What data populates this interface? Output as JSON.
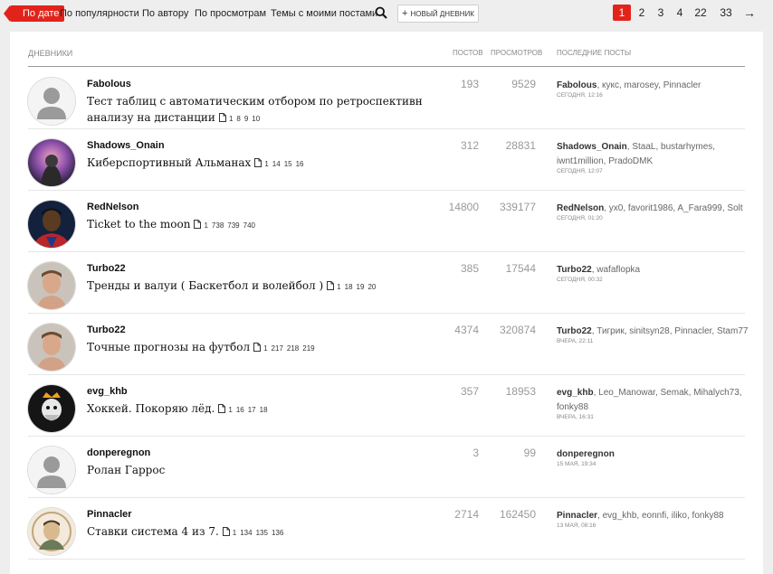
{
  "nav": {
    "active_sort": "По дате",
    "sorts": [
      "По популярности",
      "По автору",
      "По просмотрам",
      "Темы с моими постами"
    ],
    "new_diary": "новый дневник",
    "new_diary_plus": "+",
    "pages": [
      "1",
      "2",
      "3",
      "4",
      "22",
      "33"
    ],
    "next": "→"
  },
  "table": {
    "headers": {
      "diaries": "Дневники",
      "posts": "Постов",
      "views": "Просмотров",
      "last_posts": "Последние посты"
    },
    "rows": [
      {
        "author": "Fabolous",
        "title": "Тест таблиц с автоматическим отбором по ретроспективн анализу на дистанции",
        "pages": [
          "1",
          "8",
          "9",
          "10"
        ],
        "posts": "193",
        "views": "9529",
        "last_owner": "Fabolous",
        "last_others": ", кукс, marosey, Pinnacler",
        "date": "сегодня, 12:16",
        "avatar": "placeholder"
      },
      {
        "author": "Shadows_Onain",
        "title": "Киберспортивный Альманах",
        "pages": [
          "1",
          "14",
          "15",
          "16"
        ],
        "posts": "312",
        "views": "28831",
        "last_owner": "Shadows_Onain",
        "last_others": ", StaaL, bustarhymes, iwnt1million, PradoDMK",
        "date": "сегодня, 12:07",
        "avatar": "purple"
      },
      {
        "author": "RedNelson",
        "title": "Ticket to the moon",
        "pages": [
          "1",
          "738",
          "739",
          "740"
        ],
        "posts": "14800",
        "views": "339177",
        "last_owner": "RedNelson",
        "last_others": ", yx0, favorit1986, A_Fara999, Solt",
        "date": "сегодня, 01:20",
        "avatar": "player"
      },
      {
        "author": "Turbo22",
        "title": "Тренды и валуи ( Баскетбол и волейбол )",
        "pages": [
          "1",
          "18",
          "19",
          "20"
        ],
        "posts": "385",
        "views": "17544",
        "last_owner": "Turbo22",
        "last_others": ", wafaflopka",
        "date": "сегодня, 00:32",
        "avatar": "man"
      },
      {
        "author": "Turbo22",
        "title": "Точные прогнозы на футбол",
        "pages": [
          "1",
          "217",
          "218",
          "219"
        ],
        "posts": "4374",
        "views": "320874",
        "last_owner": "Turbo22",
        "last_others": ", Тигрик, sinitsyn28, Pinnacler, Stam77",
        "date": "вчера, 22:11",
        "avatar": "man"
      },
      {
        "author": "evg_khb",
        "title": "Хоккей. Покоряю лёд.",
        "pages": [
          "1",
          "16",
          "17",
          "18"
        ],
        "posts": "357",
        "views": "18953",
        "last_owner": "evg_khb",
        "last_others": ", Leo_Manowar, Semak, Mihalych73, fonky88",
        "date": "вчера, 16:31",
        "avatar": "dark"
      },
      {
        "author": "donperegnon",
        "title": "Ролан Гаррос",
        "pages": [],
        "posts": "3",
        "views": "99",
        "last_owner": "donperegnon",
        "last_others": "",
        "date": "15 мая, 19:34",
        "avatar": "placeholder"
      },
      {
        "author": "Pinnacler",
        "title": "Ставки система 4 из 7.",
        "pages": [
          "1",
          "134",
          "135",
          "136"
        ],
        "posts": "2714",
        "views": "162450",
        "last_owner": "Pinnacler",
        "last_others": ", evg_khb, eonnfi, iliko, fonky88",
        "date": "13 мая, 08:16",
        "avatar": "sketch"
      }
    ]
  },
  "colors": {
    "accent": "#e2231a",
    "background": "#eeeeee",
    "panel": "#ffffff"
  },
  "icons": [
    "search-icon",
    "doc-icon",
    "arrow-right-icon",
    "plus-icon"
  ]
}
